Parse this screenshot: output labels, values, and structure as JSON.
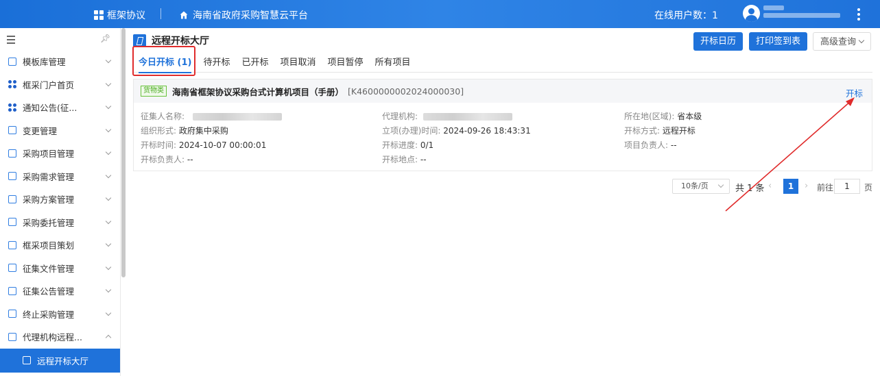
{
  "topbar": {
    "brand": "框架协议",
    "platform": "海南省政府采购智慧云平台",
    "online_users": "在线用户数：1"
  },
  "sidebar": {
    "items": [
      {
        "label": "模板库管理",
        "icon": "template-icon"
      },
      {
        "label": "框采门户首页",
        "icon": "dots-icon"
      },
      {
        "label": "通知公告(征...",
        "icon": "dots-icon"
      },
      {
        "label": "变更管理",
        "icon": "change-icon"
      },
      {
        "label": "采购项目管理",
        "icon": "folder-icon"
      },
      {
        "label": "采购需求管理",
        "icon": "doc-icon"
      },
      {
        "label": "采购方案管理",
        "icon": "doc-icon"
      },
      {
        "label": "采购委托管理",
        "icon": "doc-icon"
      },
      {
        "label": "框采项目策划",
        "icon": "folder-icon"
      },
      {
        "label": "征集文件管理",
        "icon": "doc-icon"
      },
      {
        "label": "征集公告管理",
        "icon": "doc-icon"
      },
      {
        "label": "终止采购管理",
        "icon": "stop-icon"
      },
      {
        "label": "代理机构远程...",
        "icon": "doc-icon"
      }
    ],
    "active_sub": "远程开标大厅"
  },
  "page": {
    "title": "远程开标大厅",
    "buttons": {
      "calendar": "开标日历",
      "print": "打印签到表",
      "advanced": "高级查询"
    }
  },
  "tabs": [
    "今日开标 (1)",
    "待开标",
    "已开标",
    "项目取消",
    "项目暂停",
    "所有项目"
  ],
  "project": {
    "tag": "货物类",
    "name": "海南省框架协议采购台式计算机项目（手册）",
    "code": "[K4600000002024000030]",
    "action": "开标",
    "fields": {
      "collector_label": "征集人名称:",
      "agency_label": "代理机构:",
      "region_label": "所在地(区域):",
      "region_value": "省本级",
      "org_label": "组织形式:",
      "org_value": "政府集中采购",
      "time_label": "立项(办理)时间:",
      "time_value": "2024-09-26 18:43:31",
      "method_label": "开标方式:",
      "method_value": "远程开标",
      "open_time_label": "开标时间:",
      "open_time_value": "2024-10-07 00:00:01",
      "progress_label": "开标进度:",
      "progress_value": "0/1",
      "leader_label": "项目负责人:",
      "leader_value": "--",
      "open_leader_label": "开标负责人:",
      "open_leader_value": "--",
      "place_label": "开标地点:",
      "place_value": "--"
    }
  },
  "pagination": {
    "page_size": "10条/页",
    "total": "共 1 条",
    "current": "1",
    "goto_label": "前往",
    "goto_value": "1",
    "page_suffix": "页"
  },
  "colors": {
    "primary": "#1f72da",
    "annotation": "#e02b2b",
    "tag_green": "#67c23a"
  }
}
